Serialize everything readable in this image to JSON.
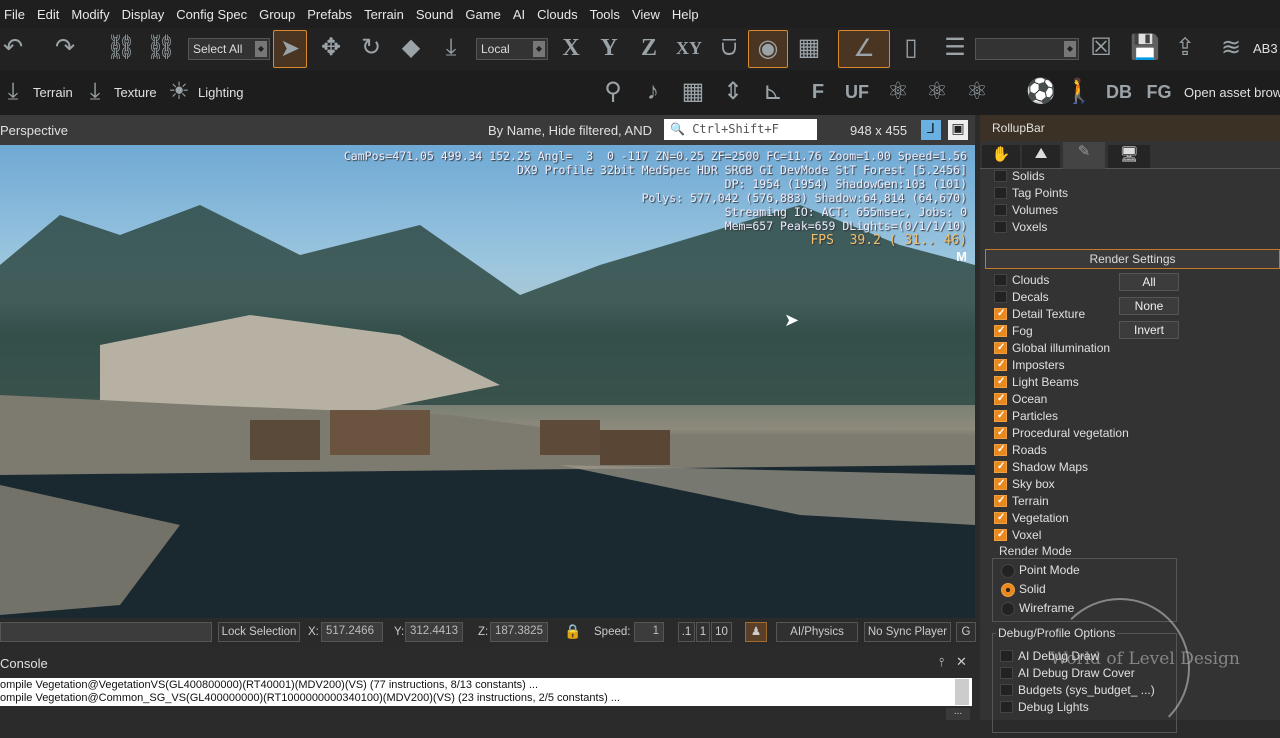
{
  "menu": [
    "File",
    "Edit",
    "Modify",
    "Display",
    "Config Spec",
    "Group",
    "Prefabs",
    "Terrain",
    "Sound",
    "Game",
    "AI",
    "Clouds",
    "Tools",
    "View",
    "Help"
  ],
  "toolbar": {
    "select_filter": "Select All",
    "coord_system": "Local",
    "axis_x": "X",
    "axis_y": "Y",
    "axis_z": "Z",
    "axis_xy": "XY",
    "layer_label": "AB3",
    "terrain": "Terrain",
    "texture": "Texture",
    "lighting": "Lighting",
    "f_btn": "F",
    "uf_btn": "UF",
    "db_btn": "DB",
    "fg_btn": "FG",
    "asset_browser": "Open asset brows"
  },
  "viewport": {
    "title": "Perspective",
    "filter_info": "By Name, Hide filtered, AND",
    "search_placeholder": "Ctrl+Shift+F",
    "resolution": "948 x 455",
    "marker": "M",
    "overlay": [
      "CamPos=471.05 499.34 152.25 Angl=  3  0 -117 ZN=0.25 ZF=2500 FC=11.76 Zoom=1.00 Speed=1.56",
      "DX9 Profile 32bit MedSpec HDR SRGB GI DevMode StT Forest [5.2456]",
      "DP: 1954 (1954) ShadowGen:103 (101)",
      "Polys: 577,042 (576,883) Shadow:64,814 (64,670)",
      "Streaming IO: ACT: 655msec, Jobs: 0",
      "Mem=657 Peak=659 DLights=(0/1/1/10)"
    ],
    "fps": "FPS  39.2 ( 31.. 46)"
  },
  "status": {
    "lock_selection": "Lock Selection",
    "x_label": "X:",
    "x": "517.2466",
    "y_label": "Y:",
    "y": "312.4413",
    "z_label": "Z:",
    "z": "187.3825",
    "speed_label": "Speed:",
    "speed": "1",
    "speed_presets": [
      ".1",
      "1",
      "10"
    ],
    "ai_physics": "AI/Physics",
    "no_sync_player": "No Sync Player",
    "g": "G"
  },
  "console": {
    "title": "Console",
    "lines": [
      "ompile Vegetation@VegetationVS(GL400800000)(RT40001)(MDV200)(VS) (77 instructions, 8/13 constants) ...",
      "ompile Vegetation@Common_SG_VS(GL400000000)(RT1000000000340100)(MDV200)(VS) (23 instructions, 2/5 constants) ..."
    ],
    "more": "..."
  },
  "rollup": {
    "title": "RollupBar",
    "top_items": [
      {
        "label": "Solids",
        "checked": false
      },
      {
        "label": "Tag Points",
        "checked": false
      },
      {
        "label": "Volumes",
        "checked": false
      },
      {
        "label": "Voxels",
        "checked": false
      }
    ],
    "render_settings": "Render Settings",
    "buttons": {
      "all": "All",
      "none": "None",
      "invert": "Invert"
    },
    "render_items": [
      {
        "label": "Clouds",
        "checked": false
      },
      {
        "label": "Decals",
        "checked": false
      },
      {
        "label": "Detail Texture",
        "checked": true
      },
      {
        "label": "Fog",
        "checked": true
      },
      {
        "label": "Global illumination",
        "checked": true
      },
      {
        "label": "Imposters",
        "checked": true
      },
      {
        "label": "Light Beams",
        "checked": true
      },
      {
        "label": "Ocean",
        "checked": true
      },
      {
        "label": "Particles",
        "checked": true
      },
      {
        "label": "Procedural vegetation",
        "checked": true
      },
      {
        "label": "Roads",
        "checked": true
      },
      {
        "label": "Shadow Maps",
        "checked": true
      },
      {
        "label": "Sky box",
        "checked": true
      },
      {
        "label": "Terrain",
        "checked": true
      },
      {
        "label": "Vegetation",
        "checked": true
      },
      {
        "label": "Voxel",
        "checked": true
      }
    ],
    "render_mode": {
      "title": "Render Mode",
      "options": [
        "Point Mode",
        "Solid",
        "Wireframe"
      ],
      "selected": "Solid"
    },
    "debug": {
      "title": "Debug/Profile Options",
      "items": [
        "AI Debug Draw",
        "AI Debug Draw Cover",
        "Budgets (sys_budget_ ...)",
        "Debug Lights"
      ]
    },
    "watermark": "World of Level Design"
  },
  "colors": {
    "accent": "#e8891f",
    "background": "#2b2b2b"
  }
}
